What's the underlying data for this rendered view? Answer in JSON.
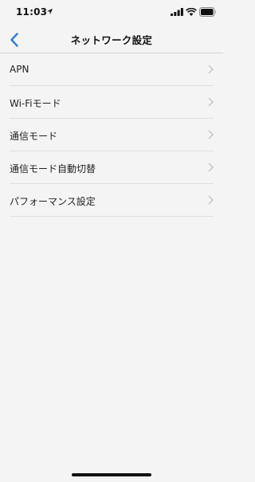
{
  "status_bar": {
    "time": "11:03",
    "location_icon": "location-arrow-icon",
    "signal_icon": "cellular-signal-icon",
    "wifi_icon": "wifi-icon",
    "battery_icon": "battery-icon"
  },
  "nav": {
    "title": "ネットワーク設定",
    "back_icon": "chevron-left-icon",
    "accent_color": "#2f7fd6"
  },
  "menu": {
    "items": [
      {
        "label": "APN"
      },
      {
        "label": "Wi-Fiモード"
      },
      {
        "label": "通信モード"
      },
      {
        "label": "通信モード自動切替"
      },
      {
        "label": "パフォーマンス設定"
      }
    ],
    "chevron_icon": "chevron-right-icon"
  }
}
